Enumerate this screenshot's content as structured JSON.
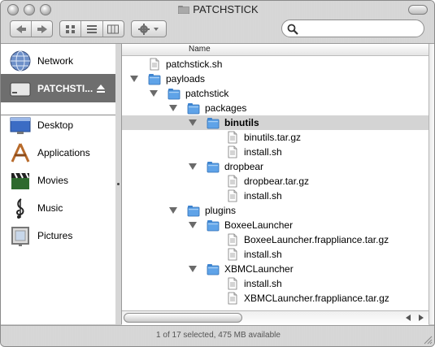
{
  "window": {
    "title": "PATCHSTICK"
  },
  "toolbar": {
    "back_icon": "back-arrow-icon",
    "forward_icon": "forward-arrow-icon",
    "views": [
      "icon-view-icon",
      "list-view-icon",
      "column-view-icon"
    ],
    "action_icon": "gear-icon",
    "search": {
      "value": "",
      "placeholder": ""
    }
  },
  "sidebar": {
    "items": [
      {
        "label": "Network",
        "icon": "network-globe-icon"
      },
      {
        "label": "PATCHSTI...",
        "icon": "drive-icon",
        "eject": "eject-icon",
        "selected": true
      },
      {
        "label": "Desktop",
        "icon": "desktop-icon"
      },
      {
        "label": "Applications",
        "icon": "applications-icon"
      },
      {
        "label": "Movies",
        "icon": "movies-clapper-icon"
      },
      {
        "label": "Music",
        "icon": "music-clef-icon"
      },
      {
        "label": "Pictures",
        "icon": "pictures-frame-icon"
      }
    ]
  },
  "list": {
    "column_header": "Name",
    "rows": [
      {
        "name": "patchstick.sh",
        "kind": "file",
        "depth": 0,
        "expanded": false
      },
      {
        "name": "payloads",
        "kind": "folder",
        "depth": 0,
        "expanded": true
      },
      {
        "name": "patchstick",
        "kind": "folder",
        "depth": 1,
        "expanded": true
      },
      {
        "name": "packages",
        "kind": "folder",
        "depth": 2,
        "expanded": true
      },
      {
        "name": "binutils",
        "kind": "folder",
        "depth": 3,
        "expanded": true,
        "selected": true
      },
      {
        "name": "binutils.tar.gz",
        "kind": "file",
        "depth": 4,
        "expanded": false
      },
      {
        "name": "install.sh",
        "kind": "file",
        "depth": 4,
        "expanded": false
      },
      {
        "name": "dropbear",
        "kind": "folder",
        "depth": 3,
        "expanded": true
      },
      {
        "name": "dropbear.tar.gz",
        "kind": "file",
        "depth": 4,
        "expanded": false
      },
      {
        "name": "install.sh",
        "kind": "file",
        "depth": 4,
        "expanded": false
      },
      {
        "name": "plugins",
        "kind": "folder",
        "depth": 2,
        "expanded": true
      },
      {
        "name": "BoxeeLauncher",
        "kind": "folder",
        "depth": 3,
        "expanded": true
      },
      {
        "name": "BoxeeLauncher.frappliance.tar.gz",
        "kind": "file",
        "depth": 4,
        "expanded": false
      },
      {
        "name": "install.sh",
        "kind": "file",
        "depth": 4,
        "expanded": false
      },
      {
        "name": "XBMCLauncher",
        "kind": "folder",
        "depth": 3,
        "expanded": true
      },
      {
        "name": "install.sh",
        "kind": "file",
        "depth": 4,
        "expanded": false
      },
      {
        "name": "XBMCLauncher.frappliance.tar.gz",
        "kind": "file",
        "depth": 4,
        "expanded": false
      }
    ]
  },
  "status": {
    "text": "1 of 17 selected, 475 MB available"
  },
  "colors": {
    "selection": "#d4d4d4",
    "sidebar_selected": "#6e6e6e",
    "folder": "#5fa3e8"
  }
}
